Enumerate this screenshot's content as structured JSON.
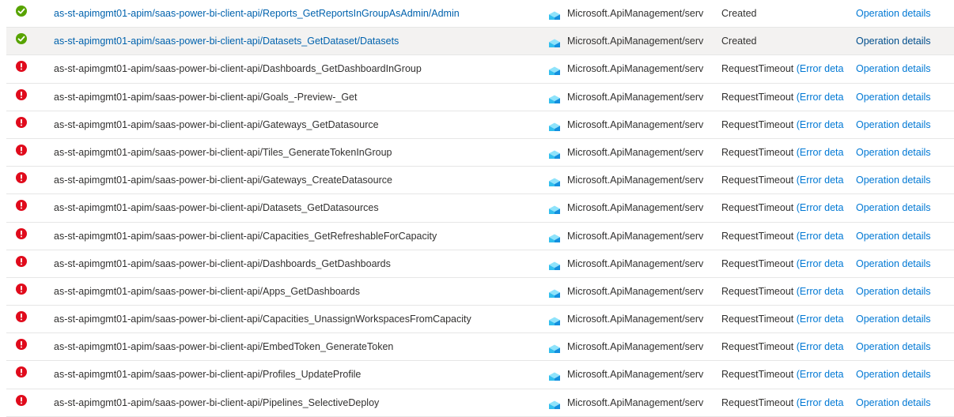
{
  "colors": {
    "success": "#57a300",
    "error": "#e00b1c",
    "link": "#0078d4",
    "selected_row": "#f3f2f1"
  },
  "rows": [
    {
      "status": "success",
      "operation": "as-st-apimgmt01-apim/saas-power-bi-client-api/Reports_GetReportsInGroupAsAdmin/Admin",
      "resource_type": "Microsoft.ApiManagement/serv",
      "status_text": "Created",
      "error_link": "",
      "details_label": "Operation details"
    },
    {
      "status": "success",
      "operation": "as-st-apimgmt01-apim/saas-power-bi-client-api/Datasets_GetDataset/Datasets",
      "resource_type": "Microsoft.ApiManagement/serv",
      "status_text": "Created",
      "error_link": "",
      "details_label": "Operation details"
    },
    {
      "status": "error",
      "operation": "as-st-apimgmt01-apim/saas-power-bi-client-api/Dashboards_GetDashboardInGroup",
      "resource_type": "Microsoft.ApiManagement/serv",
      "status_text": "RequestTimeout",
      "error_link": "(Error deta",
      "details_label": "Operation details"
    },
    {
      "status": "error",
      "operation": "as-st-apimgmt01-apim/saas-power-bi-client-api/Goals_-Preview-_Get",
      "resource_type": "Microsoft.ApiManagement/serv",
      "status_text": "RequestTimeout",
      "error_link": "(Error deta",
      "details_label": "Operation details"
    },
    {
      "status": "error",
      "operation": "as-st-apimgmt01-apim/saas-power-bi-client-api/Gateways_GetDatasource",
      "resource_type": "Microsoft.ApiManagement/serv",
      "status_text": "RequestTimeout",
      "error_link": "(Error deta",
      "details_label": "Operation details"
    },
    {
      "status": "error",
      "operation": "as-st-apimgmt01-apim/saas-power-bi-client-api/Tiles_GenerateTokenInGroup",
      "resource_type": "Microsoft.ApiManagement/serv",
      "status_text": "RequestTimeout",
      "error_link": "(Error deta",
      "details_label": "Operation details"
    },
    {
      "status": "error",
      "operation": "as-st-apimgmt01-apim/saas-power-bi-client-api/Gateways_CreateDatasource",
      "resource_type": "Microsoft.ApiManagement/serv",
      "status_text": "RequestTimeout",
      "error_link": "(Error deta",
      "details_label": "Operation details"
    },
    {
      "status": "error",
      "operation": "as-st-apimgmt01-apim/saas-power-bi-client-api/Datasets_GetDatasources",
      "resource_type": "Microsoft.ApiManagement/serv",
      "status_text": "RequestTimeout",
      "error_link": "(Error deta",
      "details_label": "Operation details"
    },
    {
      "status": "error",
      "operation": "as-st-apimgmt01-apim/saas-power-bi-client-api/Capacities_GetRefreshableForCapacity",
      "resource_type": "Microsoft.ApiManagement/serv",
      "status_text": "RequestTimeout",
      "error_link": "(Error deta",
      "details_label": "Operation details"
    },
    {
      "status": "error",
      "operation": "as-st-apimgmt01-apim/saas-power-bi-client-api/Dashboards_GetDashboards",
      "resource_type": "Microsoft.ApiManagement/serv",
      "status_text": "RequestTimeout",
      "error_link": "(Error deta",
      "details_label": "Operation details"
    },
    {
      "status": "error",
      "operation": "as-st-apimgmt01-apim/saas-power-bi-client-api/Apps_GetDashboards",
      "resource_type": "Microsoft.ApiManagement/serv",
      "status_text": "RequestTimeout",
      "error_link": "(Error deta",
      "details_label": "Operation details"
    },
    {
      "status": "error",
      "operation": "as-st-apimgmt01-apim/saas-power-bi-client-api/Capacities_UnassignWorkspacesFromCapacity",
      "resource_type": "Microsoft.ApiManagement/serv",
      "status_text": "RequestTimeout",
      "error_link": "(Error deta",
      "details_label": "Operation details"
    },
    {
      "status": "error",
      "operation": "as-st-apimgmt01-apim/saas-power-bi-client-api/EmbedToken_GenerateToken",
      "resource_type": "Microsoft.ApiManagement/serv",
      "status_text": "RequestTimeout",
      "error_link": "(Error deta",
      "details_label": "Operation details"
    },
    {
      "status": "error",
      "operation": "as-st-apimgmt01-apim/saas-power-bi-client-api/Profiles_UpdateProfile",
      "resource_type": "Microsoft.ApiManagement/serv",
      "status_text": "RequestTimeout",
      "error_link": "(Error deta",
      "details_label": "Operation details"
    },
    {
      "status": "error",
      "operation": "as-st-apimgmt01-apim/saas-power-bi-client-api/Pipelines_SelectiveDeploy",
      "resource_type": "Microsoft.ApiManagement/serv",
      "status_text": "RequestTimeout",
      "error_link": "(Error deta",
      "details_label": "Operation details"
    }
  ],
  "selected_row_index": 1,
  "linked_operation_rows": [
    0,
    1
  ]
}
